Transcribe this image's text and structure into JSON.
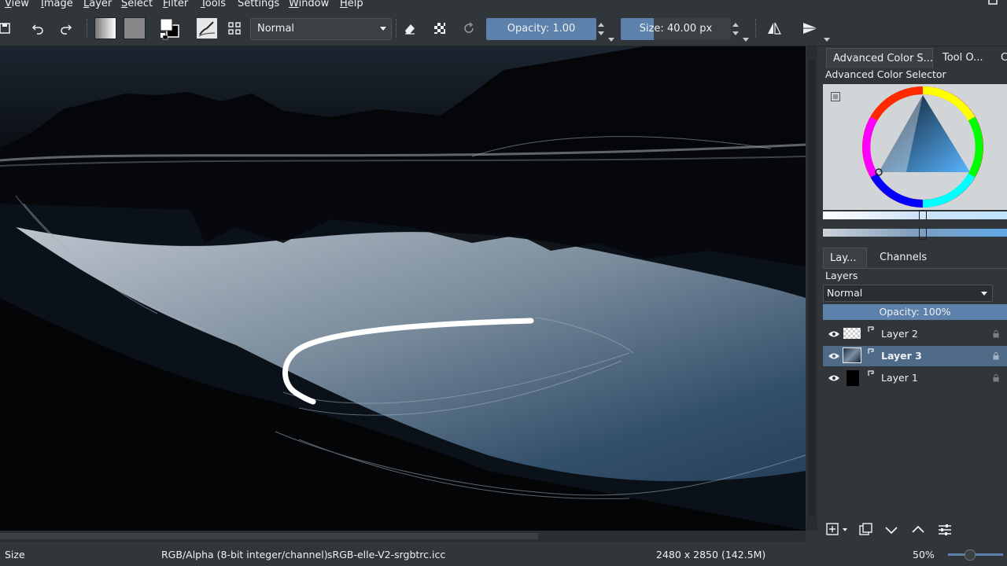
{
  "menu": [
    "View",
    "Image",
    "Layer",
    "Select",
    "Filter",
    "Tools",
    "Settings",
    "Window",
    "Help"
  ],
  "toolbar": {
    "blend_mode": "Normal",
    "opacity_label": "Opacity:",
    "opacity_value": "1.00",
    "opacity_fraction": 1.0,
    "size_label": "Size:",
    "size_value": "40.00 px",
    "size_fraction": 0.3
  },
  "dock": {
    "tabs": [
      "Advanced Color S...",
      "Tool O...",
      "C"
    ],
    "color_selector_title": "Advanced Color Selector",
    "layer_tabs": [
      "Lay...",
      "Channels"
    ],
    "layers_title": "Layers",
    "layers_blend_mode": "Normal",
    "layers_opacity": "Opacity:  100%",
    "layers": [
      {
        "name": "Layer 2",
        "selected": false
      },
      {
        "name": "Layer 3",
        "selected": true
      },
      {
        "name": "Layer 1",
        "selected": false
      }
    ]
  },
  "statusbar": {
    "tool": "Size",
    "color_space": "RGB/Alpha (8-bit integer/channel)",
    "profile": "sRGB-elle-V2-srgbtrc.icc",
    "dimensions": "2480 x 2850 (142.5M)",
    "zoom": "50%"
  },
  "colors": {
    "accent": "#5c82ab",
    "selected_layer": "#4f6a87",
    "panel_bg": "#31363b"
  }
}
